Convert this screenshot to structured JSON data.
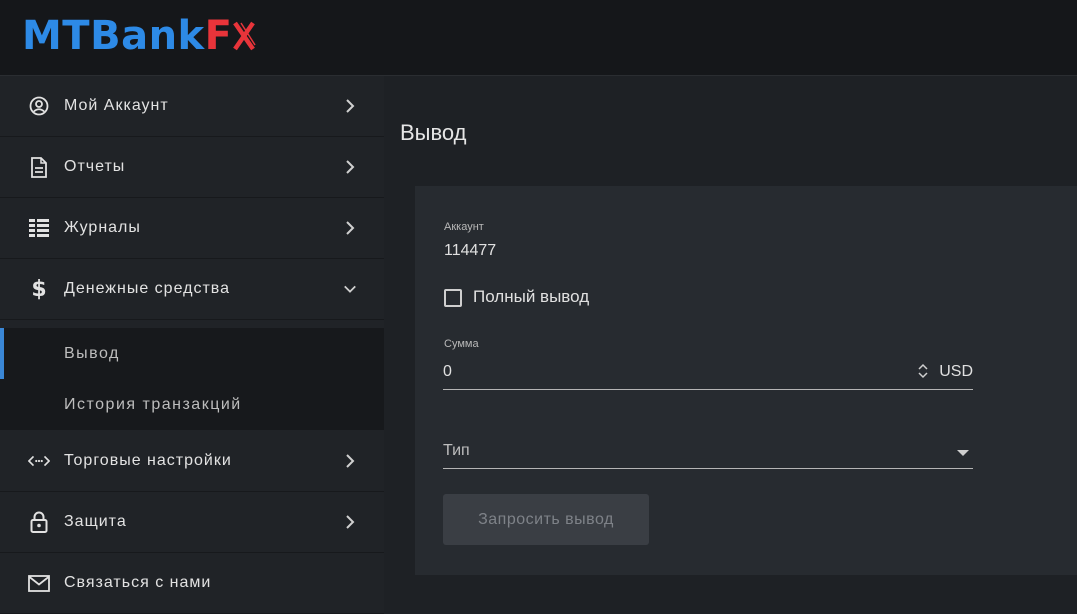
{
  "logo": {
    "part1": "MTBank",
    "part2": "F",
    "part3": "X"
  },
  "sidebar": {
    "items": [
      {
        "label": "Мой Аккаунт",
        "icon": "user-circle-icon"
      },
      {
        "label": "Отчеты",
        "icon": "document-icon"
      },
      {
        "label": "Журналы",
        "icon": "list-icon"
      },
      {
        "label": "Денежные средства",
        "icon": "dollar-icon"
      },
      {
        "label": "Торговые настройки",
        "icon": "code-arrows-icon"
      },
      {
        "label": "Защита",
        "icon": "lock-icon"
      },
      {
        "label": "Связаться с нами",
        "icon": "envelope-icon"
      }
    ],
    "subitems": [
      {
        "label": "Вывод",
        "active": true
      },
      {
        "label": "История транзакций",
        "active": false
      }
    ]
  },
  "main": {
    "title": "Вывод",
    "account_label": "Аккаунт",
    "account_value": "114477",
    "full_withdraw_label": "Полный вывод",
    "full_withdraw_checked": false,
    "amount_label": "Сумма",
    "amount_value": "0",
    "currency": "USD",
    "type_placeholder": "Тип",
    "submit_label": "Запросить вывод"
  },
  "colors": {
    "brand_blue": "#2d8ae6",
    "brand_red": "#e8343a",
    "active_indicator": "#3a87d6"
  }
}
